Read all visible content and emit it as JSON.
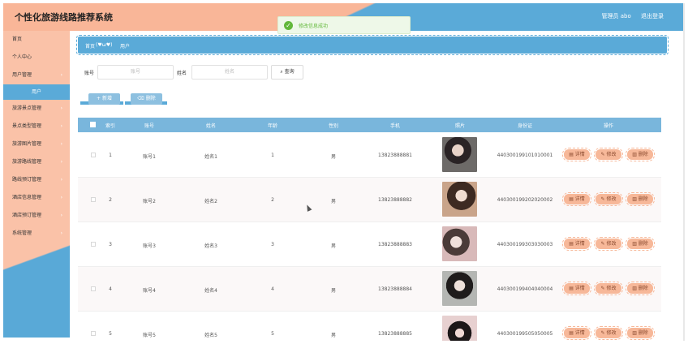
{
  "header": {
    "app_title": "个性化旅游线路推荐系统",
    "user_label": "管理员 abo",
    "logout_label": "退出登录"
  },
  "toast": {
    "message": "修改信息成功"
  },
  "sidebar": {
    "items": [
      {
        "label": "首页"
      },
      {
        "label": "个人中心"
      },
      {
        "label": "用户管理"
      },
      {
        "label": "旅游景点管理"
      },
      {
        "label": "景点类型管理"
      },
      {
        "label": "旅游图片管理"
      },
      {
        "label": "旅游路线管理"
      },
      {
        "label": "路线预订管理"
      },
      {
        "label": "酒店信息管理"
      },
      {
        "label": "酒店预订管理"
      },
      {
        "label": "系统管理"
      }
    ],
    "active_sub": "用户",
    "arrow": "›"
  },
  "breadcrumb": {
    "home": "首页",
    "separator": "(♥ω♥)",
    "current": "用户"
  },
  "search": {
    "account_label": "账号",
    "account_placeholder": "账号",
    "name_label": "姓名",
    "name_placeholder": "姓名",
    "query_label": "查询",
    "query_icon": "search-icon"
  },
  "actions": {
    "add_label": "+ 新增",
    "delete_label": "删除"
  },
  "table": {
    "headers": {
      "index": "索引",
      "account": "账号",
      "name": "姓名",
      "age": "年龄",
      "gender": "性别",
      "phone": "手机",
      "photo": "照片",
      "idcard": "身份证",
      "ops": "操作"
    },
    "rows": [
      {
        "index": "1",
        "account": "账号1",
        "name": "姓名1",
        "age": "1",
        "gender": "男",
        "phone": "13823888881",
        "idcard": "440300199101010001"
      },
      {
        "index": "2",
        "account": "账号2",
        "name": "姓名2",
        "age": "2",
        "gender": "男",
        "phone": "13823888882",
        "idcard": "440300199202020002"
      },
      {
        "index": "3",
        "account": "账号3",
        "name": "姓名3",
        "age": "3",
        "gender": "男",
        "phone": "13823888883",
        "idcard": "440300199303030003"
      },
      {
        "index": "4",
        "account": "账号4",
        "name": "姓名4",
        "age": "4",
        "gender": "男",
        "phone": "13823888884",
        "idcard": "440300199404040004"
      },
      {
        "index": "5",
        "account": "账号5",
        "name": "姓名5",
        "age": "5",
        "gender": "男",
        "phone": "13823888885",
        "idcard": "440300199505050005"
      }
    ],
    "op_detail": "详情",
    "op_edit": "修改",
    "op_delete": "删除"
  },
  "colors": {
    "peach": "#f9b698",
    "blue": "#5aaad8",
    "success": "#62b83a"
  }
}
